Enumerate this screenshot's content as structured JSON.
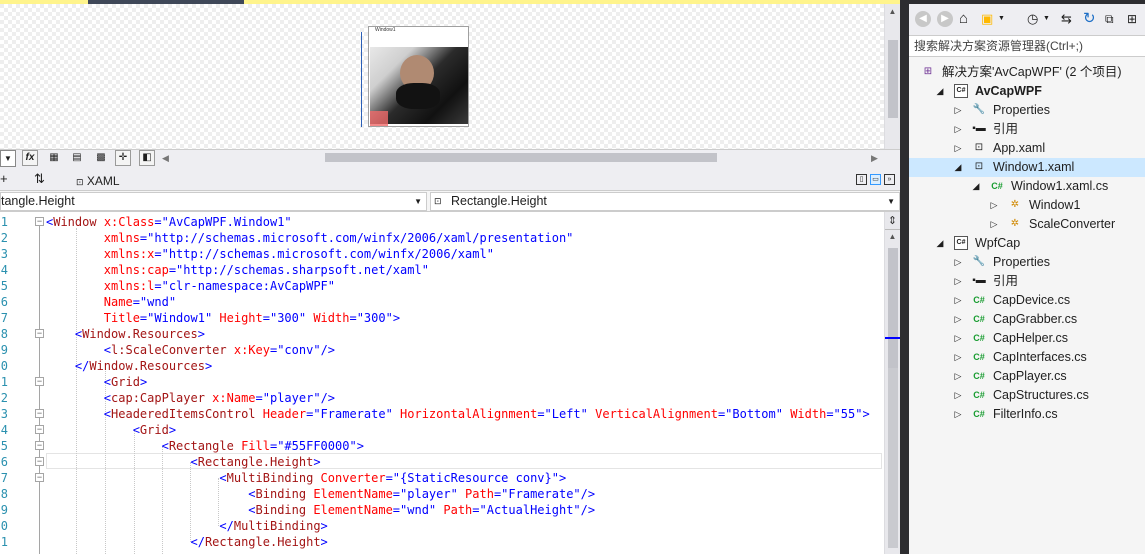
{
  "designer": {
    "preview_window_title": "Window1"
  },
  "designer_toolbar": {
    "fx_label": "fx"
  },
  "split_tabs": {
    "xaml_tab": "XAML",
    "swap_icon_label": "⇅"
  },
  "navbar": {
    "left_dropdown": "tangle.Height",
    "right_dropdown": "Rectangle.Height"
  },
  "editor": {
    "line_numbers": [
      "1",
      "2",
      "3",
      "4",
      "5",
      "6",
      "7",
      "8",
      "9",
      "0",
      "1",
      "2",
      "3",
      "4",
      "5",
      "6",
      "7",
      "8",
      "9",
      "0",
      "1"
    ],
    "lines": [
      [
        {
          "t": "<",
          "c": "brk"
        },
        {
          "t": "Window",
          "c": "tag"
        },
        {
          "t": " x:Class",
          "c": "attr"
        },
        {
          "t": "=\"AvCapWPF.Window1\"",
          "c": "val"
        }
      ],
      [
        {
          "t": "        xmlns",
          "c": "attr"
        },
        {
          "t": "=\"http://schemas.microsoft.com/winfx/2006/xaml/presentation\"",
          "c": "val"
        }
      ],
      [
        {
          "t": "        xmlns:x",
          "c": "attr"
        },
        {
          "t": "=\"http://schemas.microsoft.com/winfx/2006/xaml\"",
          "c": "val"
        }
      ],
      [
        {
          "t": "        xmlns:cap",
          "c": "attr"
        },
        {
          "t": "=\"http://schemas.sharpsoft.net/xaml\"",
          "c": "val"
        }
      ],
      [
        {
          "t": "        xmlns:l",
          "c": "attr"
        },
        {
          "t": "=\"clr-namespace:AvCapWPF\"",
          "c": "val"
        }
      ],
      [
        {
          "t": "        Name",
          "c": "attr"
        },
        {
          "t": "=\"wnd\"",
          "c": "val"
        }
      ],
      [
        {
          "t": "        Title",
          "c": "attr"
        },
        {
          "t": "=\"Window1\"",
          "c": "val"
        },
        {
          "t": " Height",
          "c": "attr"
        },
        {
          "t": "=\"300\"",
          "c": "val"
        },
        {
          "t": " Width",
          "c": "attr"
        },
        {
          "t": "=\"300\"",
          "c": "val"
        },
        {
          "t": ">",
          "c": "brk"
        }
      ],
      [
        {
          "t": "    <",
          "c": "brk"
        },
        {
          "t": "Window.Resources",
          "c": "tag"
        },
        {
          "t": ">",
          "c": "brk"
        }
      ],
      [
        {
          "t": "        <",
          "c": "brk"
        },
        {
          "t": "l:ScaleConverter",
          "c": "tag"
        },
        {
          "t": " x:Key",
          "c": "attr"
        },
        {
          "t": "=\"conv\"",
          "c": "val"
        },
        {
          "t": "/>",
          "c": "brk"
        }
      ],
      [
        {
          "t": "    </",
          "c": "brk"
        },
        {
          "t": "Window.Resources",
          "c": "tag"
        },
        {
          "t": ">",
          "c": "brk"
        }
      ],
      [
        {
          "t": "        <",
          "c": "brk"
        },
        {
          "t": "Grid",
          "c": "tag"
        },
        {
          "t": ">",
          "c": "brk"
        }
      ],
      [
        {
          "t": "        <",
          "c": "brk"
        },
        {
          "t": "cap:CapPlayer",
          "c": "tag"
        },
        {
          "t": " x:Name",
          "c": "attr"
        },
        {
          "t": "=\"player\"",
          "c": "val"
        },
        {
          "t": "/>",
          "c": "brk"
        }
      ],
      [
        {
          "t": "        <",
          "c": "brk"
        },
        {
          "t": "HeaderedItemsControl",
          "c": "tag"
        },
        {
          "t": " Header",
          "c": "attr"
        },
        {
          "t": "=\"Framerate\"",
          "c": "val"
        },
        {
          "t": " HorizontalAlignment",
          "c": "attr"
        },
        {
          "t": "=\"Left\"",
          "c": "val"
        },
        {
          "t": " VerticalAlignment",
          "c": "attr"
        },
        {
          "t": "=\"Bottom\"",
          "c": "val"
        },
        {
          "t": " Width",
          "c": "attr"
        },
        {
          "t": "=\"55\"",
          "c": "val"
        },
        {
          "t": ">",
          "c": "brk"
        }
      ],
      [
        {
          "t": "            <",
          "c": "brk"
        },
        {
          "t": "Grid",
          "c": "tag"
        },
        {
          "t": ">",
          "c": "brk"
        }
      ],
      [
        {
          "t": "                <",
          "c": "brk"
        },
        {
          "t": "Rectangle",
          "c": "tag"
        },
        {
          "t": " Fill",
          "c": "attr"
        },
        {
          "t": "=\"#55FF0000\"",
          "c": "val"
        },
        {
          "t": ">",
          "c": "brk"
        }
      ],
      [
        {
          "t": "                    <",
          "c": "brk"
        },
        {
          "t": "Rectangle.Height",
          "c": "tag"
        },
        {
          "t": ">",
          "c": "brk"
        }
      ],
      [
        {
          "t": "                        <",
          "c": "brk"
        },
        {
          "t": "MultiBinding",
          "c": "tag"
        },
        {
          "t": " Converter",
          "c": "attr"
        },
        {
          "t": "=\"{StaticResource conv}\"",
          "c": "val"
        },
        {
          "t": ">",
          "c": "brk"
        }
      ],
      [
        {
          "t": "                            <",
          "c": "brk"
        },
        {
          "t": "Binding",
          "c": "tag"
        },
        {
          "t": " ElementName",
          "c": "attr"
        },
        {
          "t": "=\"player\"",
          "c": "val"
        },
        {
          "t": " Path",
          "c": "attr"
        },
        {
          "t": "=\"Framerate\"",
          "c": "val"
        },
        {
          "t": "/>",
          "c": "brk"
        }
      ],
      [
        {
          "t": "                            <",
          "c": "brk"
        },
        {
          "t": "Binding",
          "c": "tag"
        },
        {
          "t": " ElementName",
          "c": "attr"
        },
        {
          "t": "=\"wnd\"",
          "c": "val"
        },
        {
          "t": " Path",
          "c": "attr"
        },
        {
          "t": "=\"ActualHeight\"",
          "c": "val"
        },
        {
          "t": "/>",
          "c": "brk"
        }
      ],
      [
        {
          "t": "                        </",
          "c": "brk"
        },
        {
          "t": "MultiBinding",
          "c": "tag"
        },
        {
          "t": ">",
          "c": "brk"
        }
      ],
      [
        {
          "t": "                    </",
          "c": "brk"
        },
        {
          "t": "Rectangle.Height",
          "c": "tag"
        },
        {
          "t": ">",
          "c": "brk"
        }
      ]
    ]
  },
  "solution_explorer": {
    "search_placeholder": "搜索解决方案资源管理器(Ctrl+;)",
    "items": [
      {
        "label": "解决方案'AvCapWPF' (2 个项目)",
        "icon": "solution-icon",
        "bold": false
      },
      {
        "label": "AvCapWPF",
        "icon": "csharp-project-icon",
        "bold": true
      },
      {
        "label": "Properties",
        "icon": "wrench-icon",
        "bold": false
      },
      {
        "label": "引用",
        "icon": "references-icon",
        "bold": false
      },
      {
        "label": "App.xaml",
        "icon": "xaml-file-icon",
        "bold": false
      },
      {
        "label": "Window1.xaml",
        "icon": "xaml-file-icon",
        "bold": false
      },
      {
        "label": "Window1.xaml.cs",
        "icon": "csharp-file-icon",
        "bold": false
      },
      {
        "label": "Window1",
        "icon": "class-icon",
        "bold": false
      },
      {
        "label": "ScaleConverter",
        "icon": "class-icon",
        "bold": false
      },
      {
        "label": "WpfCap",
        "icon": "csharp-project-icon",
        "bold": false
      },
      {
        "label": "Properties",
        "icon": "wrench-icon",
        "bold": false
      },
      {
        "label": "引用",
        "icon": "references-icon",
        "bold": false
      },
      {
        "label": "CapDevice.cs",
        "icon": "csharp-file-icon",
        "bold": false
      },
      {
        "label": "CapGrabber.cs",
        "icon": "csharp-file-icon",
        "bold": false
      },
      {
        "label": "CapHelper.cs",
        "icon": "csharp-file-icon",
        "bold": false
      },
      {
        "label": "CapInterfaces.cs",
        "icon": "csharp-file-icon",
        "bold": false
      },
      {
        "label": "CapPlayer.cs",
        "icon": "csharp-file-icon",
        "bold": false
      },
      {
        "label": "CapStructures.cs",
        "icon": "csharp-file-icon",
        "bold": false
      },
      {
        "label": "FilterInfo.cs",
        "icon": "csharp-file-icon",
        "bold": false
      }
    ],
    "cs_badge": "C#",
    "selected_label": "Window1.xaml"
  },
  "colors": {
    "selection": "#cce8ff",
    "tag": "#a31515",
    "attribute": "#ff0000",
    "value": "#0000ff",
    "line_number": "#2b91af"
  }
}
